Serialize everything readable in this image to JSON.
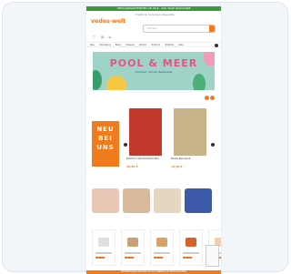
{
  "top_bar": "VERSANDKOSTENFREI AB 39 € - 100 TAGE RÜCKGABE",
  "logo": "vedes-welt",
  "meta_links": "Filialfinder  Gutscheine  Newsletter",
  "search": {
    "placeholder": "Suchen..."
  },
  "header_icons": "♡ ◎ ⌂",
  "nav_items": [
    "Neu",
    "Spielzeug",
    "Baby",
    "Puppen",
    "Spiele",
    "Outdoor",
    "Basteln",
    "Sale"
  ],
  "banner": {
    "title": "POOL & MEER",
    "subtitle": "Sommer, Sonne, Badespaß"
  },
  "new_label": "NEU\nBEI\nUNS",
  "products": [
    {
      "title": "Pokémon Sammelkarten Box",
      "price": "29,99 €",
      "color": "#c0392b"
    },
    {
      "title": "Puzzle Panorama",
      "price": "19,99 €",
      "color": "#c9b48a"
    }
  ],
  "categories": [
    {
      "color": "#e8c8b5"
    },
    {
      "color": "#d9b99b"
    },
    {
      "color": "#e6d5c0"
    },
    {
      "color": "#3d5aa8"
    }
  ],
  "product_row": [
    {
      "color": "#e0e0e0"
    },
    {
      "color": "#c9a07a"
    },
    {
      "color": "#d7a36a"
    },
    {
      "color": "#d4622a"
    },
    {
      "color": "#f0d0b0"
    }
  ],
  "footer_bar": "KOSTENLOSER VERSAND AB 39 € INNERHALB DEUTSCHLANDS"
}
